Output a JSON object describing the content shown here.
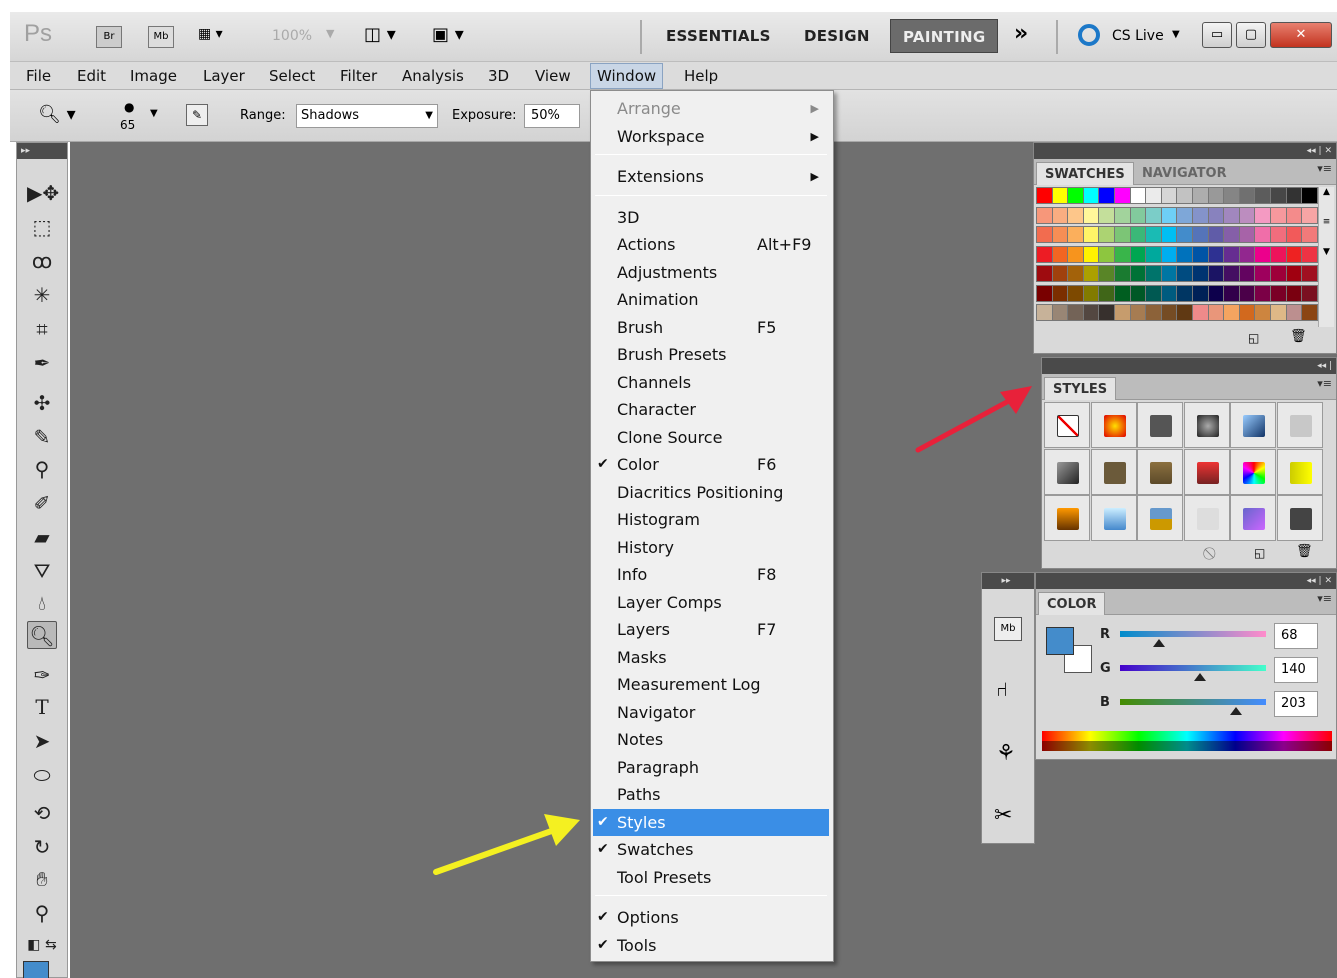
{
  "app": {
    "logo": "Ps",
    "bridge_btn": "Br",
    "minibridge_btn": "Mb",
    "zoom": "100%",
    "workspaces": [
      "ESSENTIALS",
      "DESIGN",
      "PAINTING"
    ],
    "more_workspaces": "»",
    "cslive": "CS Live"
  },
  "menubar": [
    "File",
    "Edit",
    "Image",
    "Layer",
    "Select",
    "Filter",
    "Analysis",
    "3D",
    "View",
    "Window",
    "Help"
  ],
  "options": {
    "brush_size": "65",
    "range_label": "Range:",
    "range_value": "Shadows",
    "exposure_label": "Exposure:",
    "exposure_value": "50%"
  },
  "window_menu": [
    {
      "label": "Arrange",
      "submenu": true,
      "disabled": true
    },
    {
      "label": "Workspace",
      "submenu": true
    },
    {
      "sep": true
    },
    {
      "label": "Extensions",
      "submenu": true
    },
    {
      "sep": true
    },
    {
      "label": "3D"
    },
    {
      "label": "Actions",
      "shortcut": "Alt+F9"
    },
    {
      "label": "Adjustments"
    },
    {
      "label": "Animation"
    },
    {
      "label": "Brush",
      "shortcut": "F5"
    },
    {
      "label": "Brush Presets"
    },
    {
      "label": "Channels"
    },
    {
      "label": "Character"
    },
    {
      "label": "Clone Source"
    },
    {
      "label": "Color",
      "shortcut": "F6",
      "checked": true
    },
    {
      "label": "Diacritics Positioning"
    },
    {
      "label": "Histogram"
    },
    {
      "label": "History"
    },
    {
      "label": "Info",
      "shortcut": "F8"
    },
    {
      "label": "Layer Comps"
    },
    {
      "label": "Layers",
      "shortcut": "F7"
    },
    {
      "label": "Masks"
    },
    {
      "label": "Measurement Log"
    },
    {
      "label": "Navigator"
    },
    {
      "label": "Notes"
    },
    {
      "label": "Paragraph"
    },
    {
      "label": "Paths"
    },
    {
      "label": "Styles",
      "checked": true,
      "highlighted": true
    },
    {
      "label": "Swatches",
      "checked": true
    },
    {
      "label": "Tool Presets"
    },
    {
      "sep": true
    },
    {
      "label": "Options",
      "checked": true
    },
    {
      "label": "Tools",
      "checked": true
    }
  ],
  "swatches_panel": {
    "tab_active": "SWATCHES",
    "tab_inactive": "NAVIGATOR"
  },
  "styles_panel": {
    "tab": "STYLES"
  },
  "color_panel": {
    "tab": "COLOR",
    "r_label": "R",
    "r_value": "68",
    "g_label": "G",
    "g_value": "140",
    "b_label": "B",
    "b_value": "203",
    "foreground": "#448ccb",
    "r": 68,
    "g": 140,
    "b": 203
  },
  "colors": {
    "highlight": "#3a8ee6",
    "arrow_red": "#e8213a",
    "arrow_yellow": "#f4f021",
    "canvas": "#6f6f6f"
  }
}
